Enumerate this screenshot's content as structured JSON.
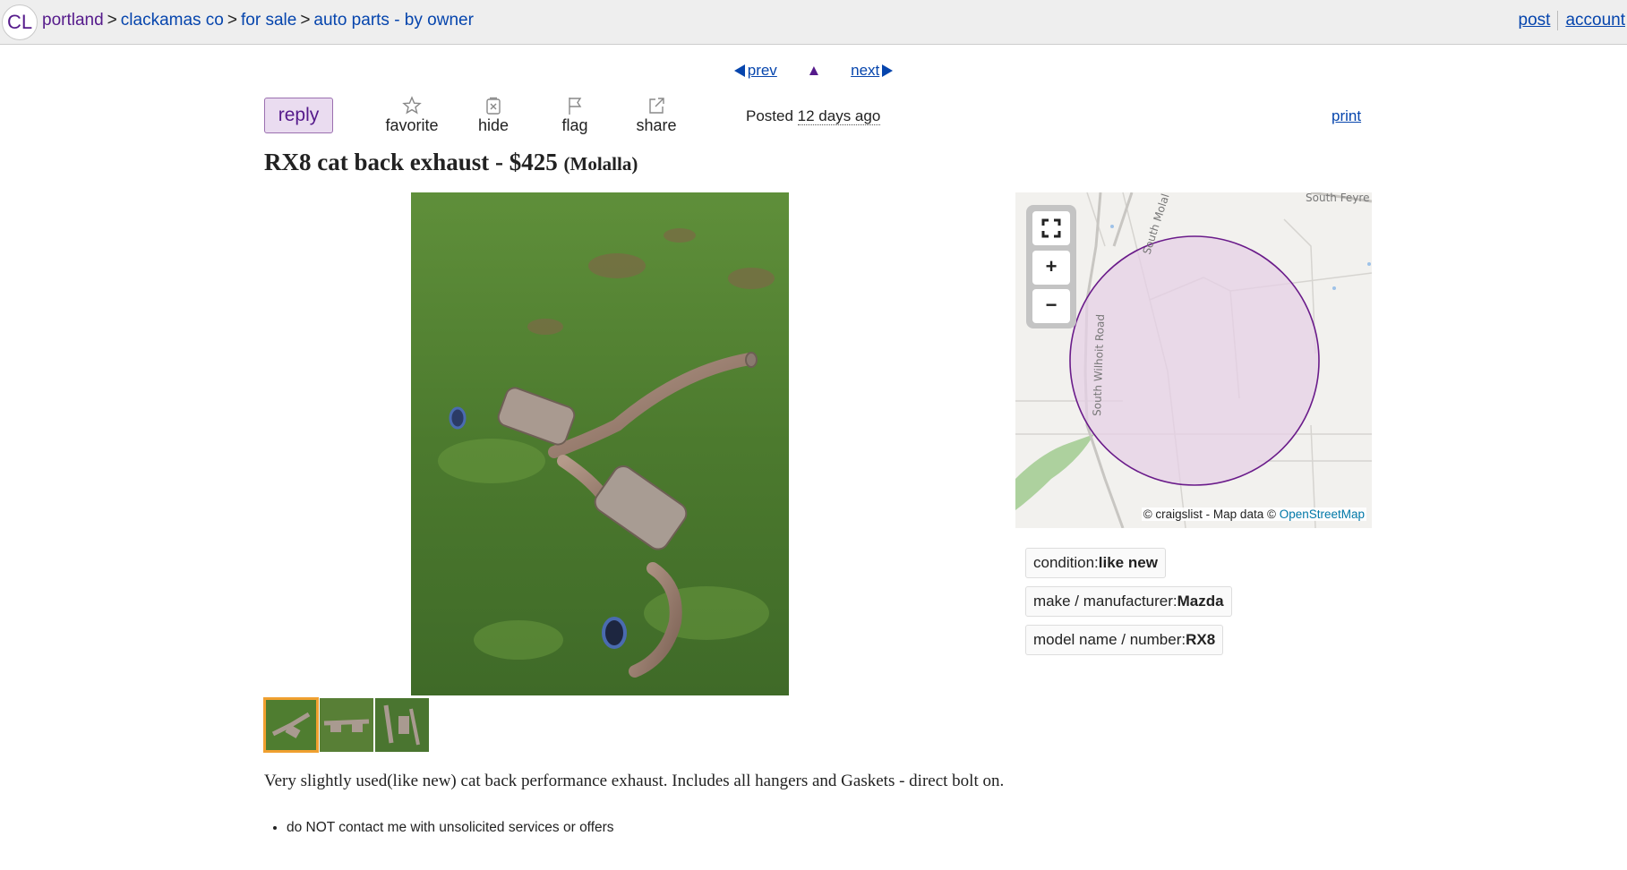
{
  "logo": "CL",
  "breadcrumbs": [
    "portland",
    "clackamas co",
    "for sale",
    "auto parts - by owner"
  ],
  "breadcrumb_sep": ">",
  "user_links": {
    "post": "post",
    "account": "account"
  },
  "pager": {
    "prev": "prev",
    "up": "▲",
    "next": "next"
  },
  "actions": {
    "reply": "reply",
    "favorite": "favorite",
    "hide": "hide",
    "flag": "flag",
    "share": "share"
  },
  "posted": {
    "label": "Posted",
    "ago": "12 days ago"
  },
  "print": "print",
  "listing": {
    "title": "RX8 cat back exhaust",
    "separator": " - ",
    "price": "$425",
    "location": "(Molalla)",
    "thumb_count": 3,
    "selected_thumb": 1
  },
  "map": {
    "attribution_prefix": "© craigslist - Map data ©",
    "attribution_link": "OpenStreetMap",
    "street_labels": [
      "South Wilhoit Road",
      "South Molal",
      "South Feyre"
    ],
    "fullscreen_icon": "fullscreen-icon",
    "zoom_in": "+",
    "zoom_out": "−"
  },
  "attributes": [
    {
      "label": "condition:",
      "value": "like new"
    },
    {
      "label": "make / manufacturer:",
      "value": "Mazda"
    },
    {
      "label": "model name / number:",
      "value": "RX8"
    }
  ],
  "body": "Very slightly used(like new) cat back performance exhaust. Includes all hangers and Gaskets - direct bolt on.",
  "notices": [
    "do NOT contact me with unsolicited services or offers"
  ],
  "colors": {
    "link": "#0645ad",
    "visited": "#551a8b",
    "reply_bg": "#eadcf0",
    "map_circle_fill": "#e6d0e6",
    "map_circle_stroke": "#6a1b8a"
  }
}
